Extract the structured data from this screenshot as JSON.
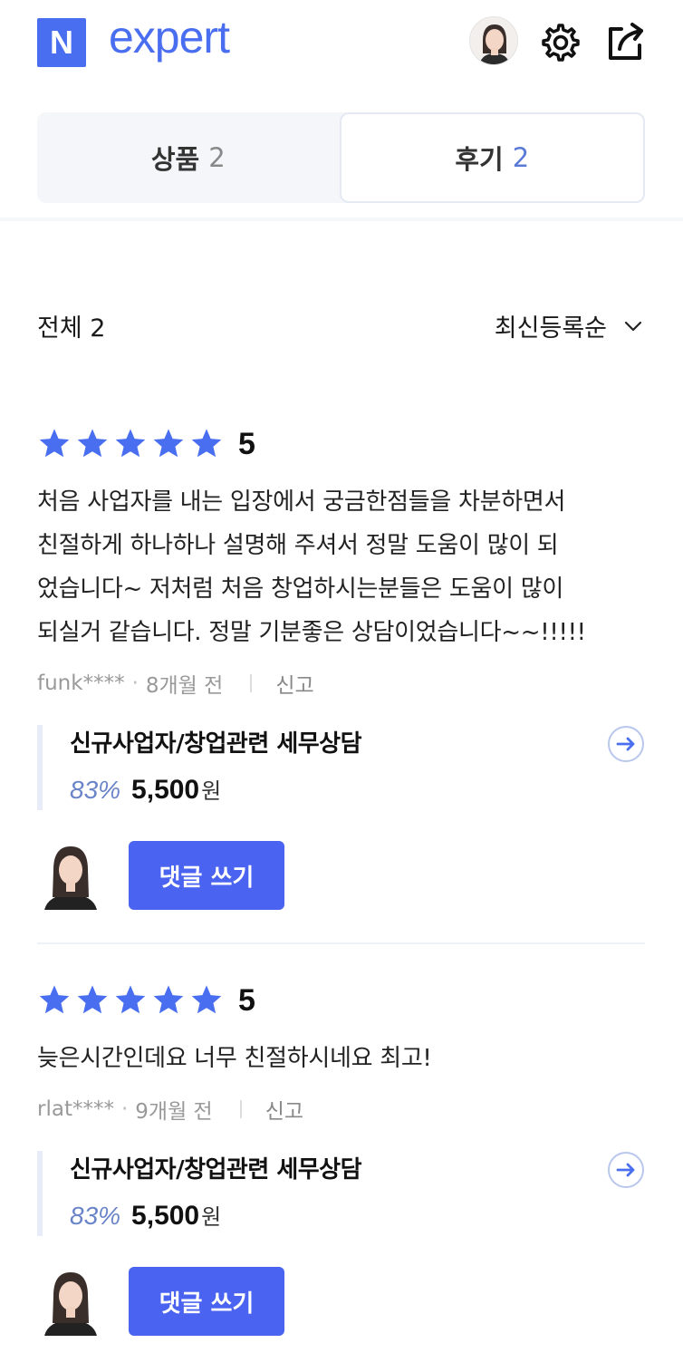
{
  "brand": {
    "logo_letter": "N",
    "logo_text": "expert",
    "accent": "#4a6ef0"
  },
  "header_icons": [
    "avatar",
    "gear-icon",
    "share-icon"
  ],
  "tabs": [
    {
      "label": "상품",
      "count": "2",
      "active": false
    },
    {
      "label": "후기",
      "count": "2",
      "active": true
    }
  ],
  "filter": {
    "total": "전체 2",
    "sort": "최신등록순"
  },
  "reviews": [
    {
      "rating": "5",
      "stars": 5,
      "lines": [
        "처음 사업자를 내는 입장에서 궁금한점들을 차분하면서",
        "친절하게 하나하나 설명해 주셔서 정말 도움이 많이 되",
        "었습니다~ 저처럼 처음 창업하시는분들은 도움이 많이",
        "되실거 같습니다. 정말 기분좋은 상담이었습니다~~!!!!!"
      ],
      "author": "funk****",
      "time": "8개월 전",
      "report": "신고",
      "product": {
        "title": "신규사업자/창업관련 세무상담",
        "discount": "83%",
        "price": "5,500",
        "currency": "원"
      },
      "comment_button": "댓글 쓰기"
    },
    {
      "rating": "5",
      "stars": 5,
      "lines": [
        "늦은시간인데요 너무 친절하시네요 최고!"
      ],
      "author": "rlat****",
      "time": "9개월 전",
      "report": "신고",
      "product": {
        "title": "신규사업자/창업관련 세무상담",
        "discount": "83%",
        "price": "5,500",
        "currency": "원"
      },
      "comment_button": "댓글 쓰기"
    }
  ]
}
